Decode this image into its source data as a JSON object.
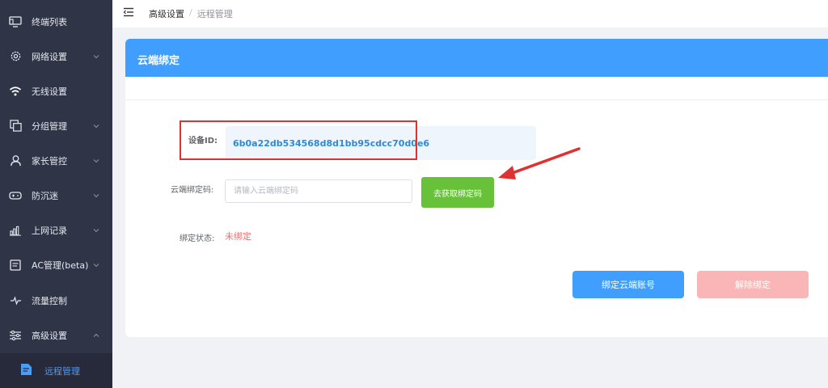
{
  "sidebar": {
    "items": [
      {
        "label": "终端列表",
        "icon": "monitor-icon"
      },
      {
        "label": "网络设置",
        "icon": "gear-icon"
      },
      {
        "label": "无线设置",
        "icon": "wifi-icon"
      },
      {
        "label": "分组管理",
        "icon": "group-icon"
      },
      {
        "label": "家长管控",
        "icon": "parent-icon"
      },
      {
        "label": "防沉迷",
        "icon": "gamepad-icon"
      },
      {
        "label": "上网记录",
        "icon": "bar-chart-icon"
      },
      {
        "label": "AC管理(beta)",
        "icon": "ac-icon"
      },
      {
        "label": "流量控制",
        "icon": "pulse-icon"
      },
      {
        "label": "高级设置",
        "icon": "sliders-icon"
      }
    ],
    "sub_item": {
      "label": "远程管理",
      "icon": "remote-doc-icon"
    }
  },
  "breadcrumb": {
    "parent": "高级设置",
    "separator": "/",
    "current": "远程管理"
  },
  "card": {
    "title": "云端绑定",
    "device_id_label": "设备ID:",
    "device_id_value": "6b0a22db534568d8d1bb95cdcc70d0e6",
    "code_label": "云端绑定码:",
    "code_placeholder": "请输入云端绑定码",
    "get_code_button": "去获取绑定码",
    "status_label": "绑定状态:",
    "status_value": "未绑定",
    "bind_button": "绑定云端账号",
    "unbind_button": "解除绑定"
  },
  "colors": {
    "sidebar_bg": "#2f3447",
    "primary": "#409eff",
    "success": "#67c23a",
    "danger": "#f56c6c",
    "annotation": "#e03131"
  }
}
